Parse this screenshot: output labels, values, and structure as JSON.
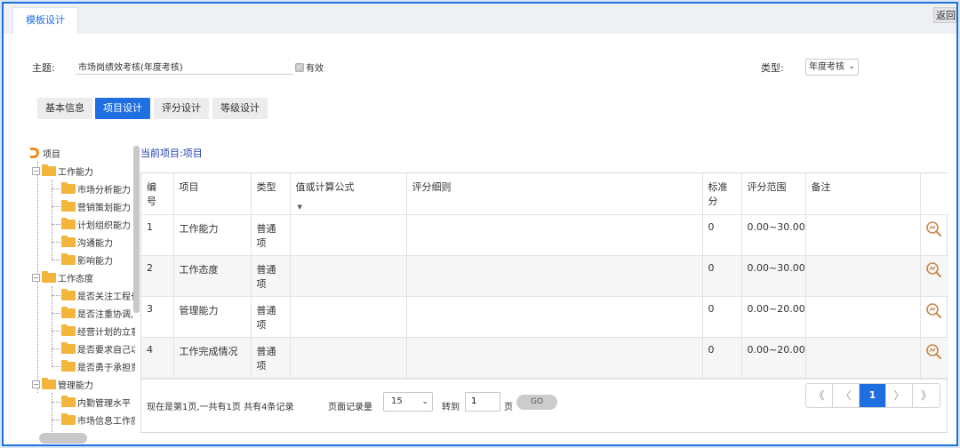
{
  "tabbar": {
    "active_tab": "模板设计",
    "back_button": "返回"
  },
  "form": {
    "subject_label": "主题:",
    "subject_value": "市场岗绩效考核(年度考核)",
    "valid_label": "有效",
    "type_label": "类型:",
    "type_value": "年度考核"
  },
  "buttons": {
    "basic": "基本信息",
    "items": "项目设计",
    "scoring": "评分设计",
    "grade": "等级设计"
  },
  "tree": {
    "root": "项目",
    "groups": [
      {
        "label": "工作能力",
        "children": [
          "市场分析能力",
          "营销策划能力",
          "计划组织能力",
          "沟通能力",
          "影响能力"
        ]
      },
      {
        "label": "工作态度",
        "children": [
          "是否关注工程长",
          "是否注重协调,",
          "经营计划的立意",
          "是否要求自己以",
          "是否勇于承担责"
        ]
      },
      {
        "label": "管理能力",
        "children": [
          "内勤管理水平",
          "市场信息工作质"
        ]
      }
    ]
  },
  "current_item": {
    "label": "当前项目:",
    "value": "项目"
  },
  "table": {
    "headers": [
      "编号",
      "项目",
      "类型",
      "值或计算公式",
      "评分细则",
      "标准分",
      "评分范围",
      "备注",
      ""
    ],
    "rows": [
      {
        "no": "1",
        "item": "工作能力",
        "type": "普通项",
        "formula": "",
        "rules": "",
        "std": "0",
        "range": "0.00~30.00",
        "note": ""
      },
      {
        "no": "2",
        "item": "工作态度",
        "type": "普通项",
        "formula": "",
        "rules": "",
        "std": "0",
        "range": "0.00~30.00",
        "note": ""
      },
      {
        "no": "3",
        "item": "管理能力",
        "type": "普通项",
        "formula": "",
        "rules": "",
        "std": "0",
        "range": "0.00~20.00",
        "note": ""
      },
      {
        "no": "4",
        "item": "工作完成情况",
        "type": "普通项",
        "formula": "",
        "rules": "",
        "std": "0",
        "range": "0.00~20.00",
        "note": ""
      }
    ]
  },
  "pager": {
    "summary": "现在是第1页,一共有1页 共有4条记录",
    "pagesize_label": "页面记录量",
    "pagesize_value": "15",
    "goto_label": "转到",
    "goto_value": "1",
    "page_unit": "页",
    "go": "GO",
    "first": "《",
    "prev": "〈",
    "current": "1",
    "next": "〉",
    "last": "》"
  },
  "colors": {
    "accent": "#1f6fe0",
    "folder": "#f4b53d",
    "view_icon": "#c8874a"
  }
}
